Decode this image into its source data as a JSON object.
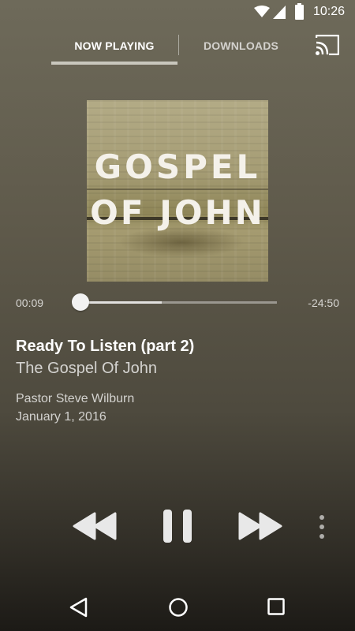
{
  "status_bar": {
    "time": "10:26",
    "icons": [
      "wifi-icon",
      "signal-icon",
      "battery-icon"
    ]
  },
  "tabs": [
    {
      "label": "NOW PLAYING",
      "active": true
    },
    {
      "label": "DOWNLOADS",
      "active": false
    }
  ],
  "toolbar": {
    "cast_icon": "cast-icon"
  },
  "album_art": {
    "line1": "GOSPEL",
    "line2": "OF JOHN"
  },
  "playback": {
    "elapsed": "00:09",
    "remaining": "-24:50",
    "progress_fraction": 0.0061,
    "buffered_fraction": 0.42
  },
  "track": {
    "title": "Ready To Listen (part 2)",
    "series": "The Gospel Of John",
    "speaker": "Pastor Steve Wilburn",
    "date": "January 1, 2016"
  },
  "controls": {
    "icons": [
      "rewind-icon",
      "pause-icon",
      "fast-forward-icon",
      "more-vert-icon"
    ]
  },
  "nav_bar": {
    "icons": [
      "back-icon",
      "home-icon",
      "recents-icon"
    ]
  },
  "colors": {
    "accent": "#ffffff",
    "tab_indicator": "#c9c7bd"
  }
}
